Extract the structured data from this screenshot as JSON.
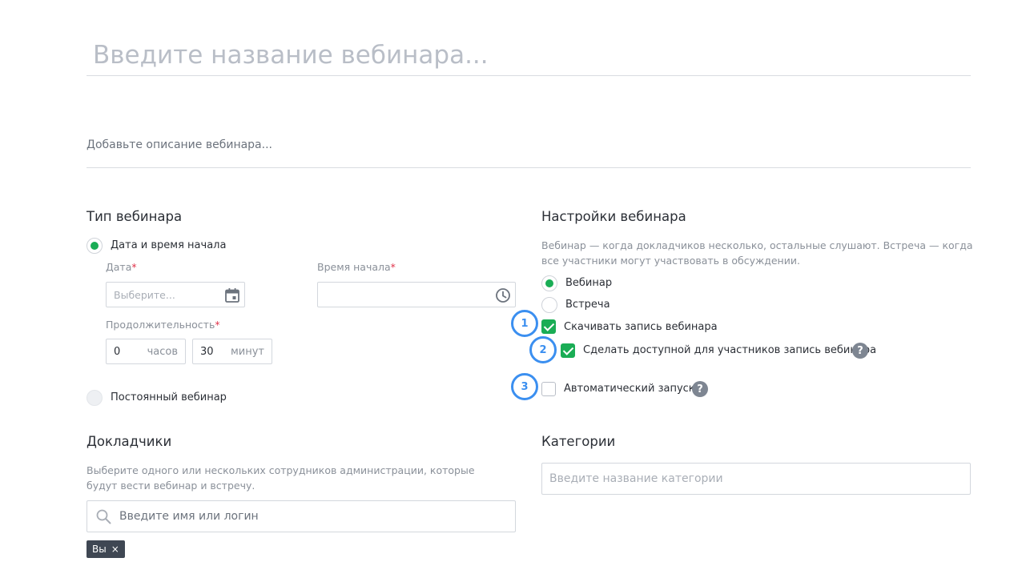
{
  "title_placeholder": "Введите название вебинара...",
  "description_placeholder": "Добавьте описание вебинара...",
  "webinar_type": {
    "heading": "Тип вебинара",
    "option_datetime": "Дата и время начала",
    "date_label": "Дата",
    "date_placeholder": "Выберите...",
    "time_label": "Время начала",
    "time_placeholder": "",
    "duration_label": "Продолжительность",
    "hours_value": "0",
    "hours_unit": "часов",
    "minutes_value": "30",
    "minutes_unit": "минут",
    "option_permanent": "Постоянный вебинар",
    "required_mark": "*",
    "selected": "datetime"
  },
  "settings": {
    "heading": "Настройки вебинара",
    "help": "Вебинар — когда докладчиков несколько, остальные слушают. Встреча — когда все участники могут участвовать в обсуждении.",
    "option_webinar": "Вебинар",
    "option_meeting": "Встреча",
    "selected": "webinar",
    "download_record": "Скачивать запись вебинара",
    "download_record_checked": true,
    "share_record": "Сделать доступной для участников запись вебинара",
    "share_record_checked": true,
    "auto_start": "Автоматический запуск",
    "auto_start_checked": false,
    "markers": [
      "1",
      "2",
      "3"
    ],
    "help_glyph": "?"
  },
  "speakers": {
    "heading": "Докладчики",
    "help": "Выберите одного или нескольких сотрудников администрации, которые будут вести вебинар и встречу.",
    "search_placeholder": "Введите имя или логин",
    "chips": [
      {
        "label": "Вы",
        "remove": "×"
      }
    ]
  },
  "categories": {
    "heading": "Категории",
    "input_placeholder": "Введите название категории"
  },
  "colors": {
    "accent_green": "#1aad55",
    "marker_blue": "#3b8ff0",
    "required_red": "#e0334a"
  }
}
